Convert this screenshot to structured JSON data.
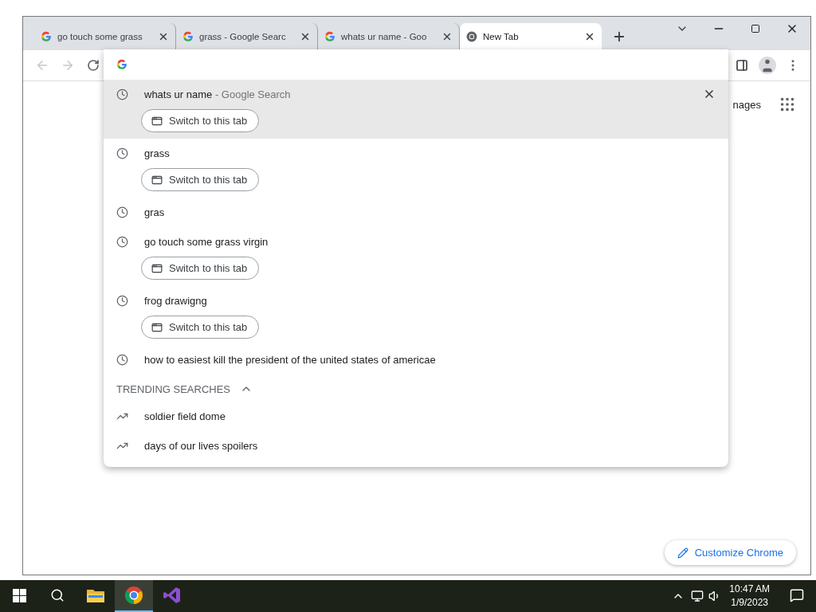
{
  "tabs": [
    {
      "title": "go touch some grass",
      "kind": "google",
      "selected": false
    },
    {
      "title": "grass - Google Searc",
      "kind": "google",
      "selected": false
    },
    {
      "title": "whats ur name - Goo",
      "kind": "google",
      "selected": false
    },
    {
      "title": "New Tab",
      "kind": "chrome",
      "selected": true
    }
  ],
  "suggestions": [
    {
      "text": "whats ur name",
      "detail": "- Google Search",
      "switch_label": "Switch to this tab",
      "selected": true
    },
    {
      "text": "grass",
      "switch_label": "Switch to this tab",
      "selected": false
    },
    {
      "text": "gras",
      "selected": false
    },
    {
      "text": "go touch some grass virgin",
      "switch_label": "Switch to this tab",
      "selected": false
    },
    {
      "text": "frog drawigng",
      "switch_label": "Switch to this tab",
      "selected": false
    },
    {
      "text": "how to easiest kill the president of the united states of americae",
      "selected": false
    }
  ],
  "trending": {
    "heading": "TRENDING SEARCHES",
    "expanded": true,
    "items": [
      "soldier field dome",
      "days of our lives spoilers"
    ]
  },
  "page": {
    "images_link": "nages",
    "customize_button": "Customize Chrome"
  },
  "taskbar": {
    "apps": [
      {
        "kind": "folder",
        "selected": false
      },
      {
        "kind": "chrome",
        "selected": true
      },
      {
        "kind": "vs",
        "selected": false
      }
    ],
    "time": "10:47 AM",
    "date": "1/9/2023"
  }
}
